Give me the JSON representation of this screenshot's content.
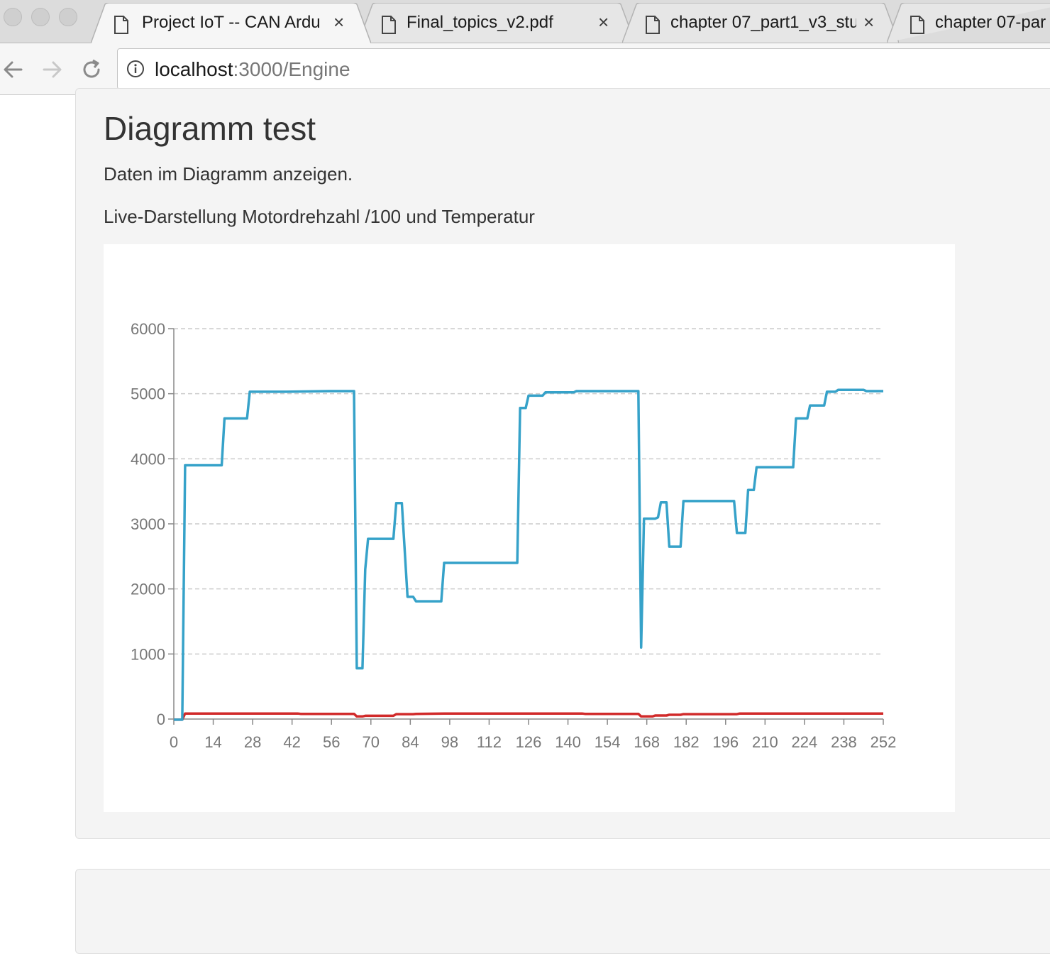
{
  "browser": {
    "tabs": [
      {
        "title": "Project IoT -- CAN Ardu",
        "active": true
      },
      {
        "title": "Final_topics_v2.pdf",
        "active": false
      },
      {
        "title": "chapter 07_part1_v3_stu",
        "active": false
      },
      {
        "title": "chapter 07-par",
        "active": false
      }
    ],
    "close_glyph": "×",
    "address": {
      "host": "localhost",
      "rest": ":3000/Engine"
    }
  },
  "page": {
    "heading": "Diagramm test",
    "intro": "Daten im Diagramm anzeigen.",
    "chart_caption": "Live-Darstellung Motordrehzahl /100 und Temperatur"
  },
  "colors": {
    "series_rpm": "#36a2c9",
    "series_temp": "#d12a2a",
    "grid": "#cccccc",
    "axis": "#888888"
  },
  "chart_data": {
    "type": "line",
    "title": "",
    "xlabel": "",
    "ylabel": "",
    "xlim": [
      0,
      252
    ],
    "ylim": [
      0,
      6000
    ],
    "x_ticks": [
      0,
      14,
      28,
      42,
      56,
      70,
      84,
      98,
      112,
      126,
      140,
      154,
      168,
      182,
      196,
      210,
      224,
      238,
      252
    ],
    "y_ticks": [
      0,
      1000,
      2000,
      3000,
      4000,
      5000,
      6000
    ],
    "grid": "horizontal dashed",
    "legend": "none",
    "series": [
      {
        "color": "#36a2c9",
        "points": [
          [
            0,
            -10
          ],
          [
            3,
            -10
          ],
          [
            4,
            3900
          ],
          [
            17,
            3900
          ],
          [
            18,
            4620
          ],
          [
            26,
            4620
          ],
          [
            27,
            5030
          ],
          [
            40,
            5030
          ],
          [
            55,
            5040
          ],
          [
            64,
            5040
          ],
          [
            65,
            780
          ],
          [
            67,
            780
          ],
          [
            68,
            2300
          ],
          [
            69,
            2770
          ],
          [
            78,
            2770
          ],
          [
            79,
            3320
          ],
          [
            81,
            3320
          ],
          [
            83,
            1880
          ],
          [
            85,
            1880
          ],
          [
            86,
            1810
          ],
          [
            95,
            1810
          ],
          [
            96,
            2400
          ],
          [
            122,
            2400
          ],
          [
            123,
            4780
          ],
          [
            125,
            4780
          ],
          [
            126,
            4970
          ],
          [
            131,
            4970
          ],
          [
            132,
            5020
          ],
          [
            142,
            5020
          ],
          [
            143,
            5040
          ],
          [
            165,
            5040
          ],
          [
            166,
            1100
          ],
          [
            167,
            3080
          ],
          [
            171,
            3080
          ],
          [
            172,
            3100
          ],
          [
            173,
            3330
          ],
          [
            175,
            3330
          ],
          [
            176,
            2650
          ],
          [
            180,
            2650
          ],
          [
            181,
            3350
          ],
          [
            199,
            3350
          ],
          [
            200,
            2860
          ],
          [
            203,
            2860
          ],
          [
            204,
            3520
          ],
          [
            206,
            3520
          ],
          [
            207,
            3870
          ],
          [
            220,
            3870
          ],
          [
            221,
            4620
          ],
          [
            225,
            4620
          ],
          [
            226,
            4820
          ],
          [
            231,
            4820
          ],
          [
            232,
            5030
          ],
          [
            235,
            5030
          ],
          [
            236,
            5060
          ],
          [
            245,
            5060
          ],
          [
            246,
            5040
          ],
          [
            252,
            5040
          ]
        ]
      },
      {
        "color": "#d12a2a",
        "points": [
          [
            0,
            -10
          ],
          [
            3,
            -10
          ],
          [
            4,
            85
          ],
          [
            44,
            85
          ],
          [
            45,
            80
          ],
          [
            64,
            80
          ],
          [
            65,
            40
          ],
          [
            67,
            40
          ],
          [
            68,
            50
          ],
          [
            78,
            50
          ],
          [
            79,
            75
          ],
          [
            85,
            75
          ],
          [
            86,
            80
          ],
          [
            96,
            85
          ],
          [
            145,
            85
          ],
          [
            146,
            80
          ],
          [
            165,
            80
          ],
          [
            166,
            40
          ],
          [
            170,
            40
          ],
          [
            171,
            55
          ],
          [
            175,
            55
          ],
          [
            176,
            65
          ],
          [
            180,
            65
          ],
          [
            181,
            75
          ],
          [
            200,
            75
          ],
          [
            201,
            85
          ],
          [
            252,
            85
          ]
        ]
      }
    ]
  }
}
